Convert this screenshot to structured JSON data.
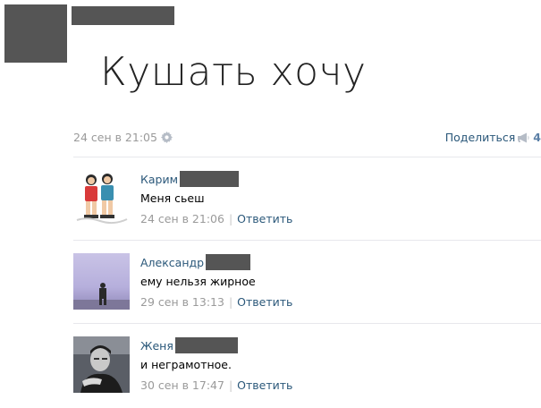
{
  "post": {
    "text": "Кушать хочу",
    "date": "24 сен в 21:05",
    "share_label": "Поделиться",
    "share_count": "4",
    "icons": {
      "settings": "gear-icon",
      "share": "megaphone-icon"
    }
  },
  "comments": [
    {
      "author": "Карим",
      "text": "Меня сьеш",
      "date": "24 сен в 21:06",
      "reply_label": "Ответить"
    },
    {
      "author": "Александр",
      "text": "ему нельзя жирное",
      "date": "29 сен в 13:13",
      "reply_label": "Ответить"
    },
    {
      "author": "Женя",
      "text": "и неграмотное.",
      "date": "30 сен в 17:47",
      "reply_label": "Ответить"
    }
  ],
  "colors": {
    "link": "#2b587a",
    "muted": "#9a9a9a",
    "redaction": "#555555",
    "divider": "#e7e8ec"
  }
}
